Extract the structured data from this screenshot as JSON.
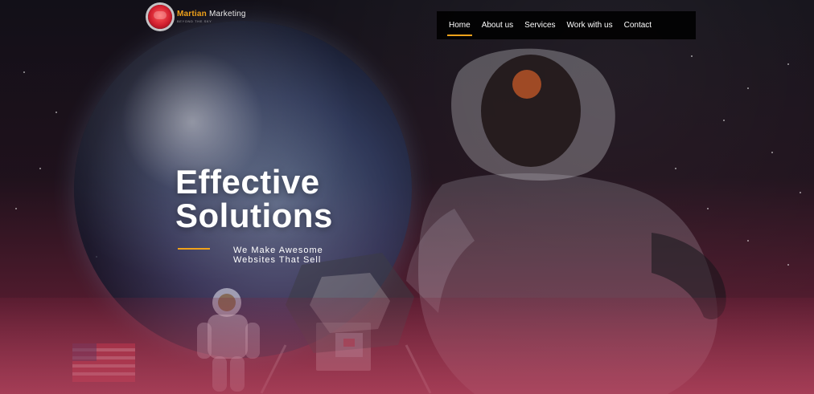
{
  "brand": {
    "name_part_1": "Martian",
    "name_part_2": " Marketing",
    "tagline": "BEYOND THE SKY"
  },
  "nav": {
    "items": [
      {
        "label": "Home",
        "active": true
      },
      {
        "label": "About us",
        "active": false
      },
      {
        "label": "Services",
        "active": false
      },
      {
        "label": "Work with us",
        "active": false
      },
      {
        "label": "Contact",
        "active": false
      }
    ]
  },
  "hero": {
    "headline_line_1": "Effective",
    "headline_line_2": "Solutions",
    "subhead_line_1": "We Make Awesome",
    "subhead_line_2": "Websites That Sell"
  },
  "colors": {
    "accent": "#f0a21a",
    "nav_bg": "#000000",
    "text": "#ffffff"
  }
}
